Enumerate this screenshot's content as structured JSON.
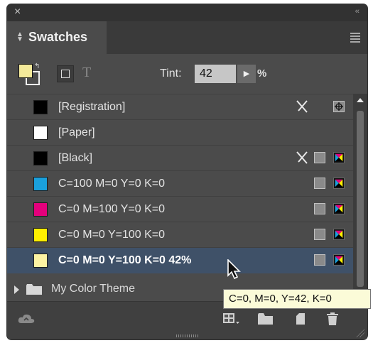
{
  "window": {
    "close_glyph": "×",
    "collapse_glyph": "‹‹"
  },
  "tab": {
    "title": "Swatches",
    "arrows_icon": "up-down-arrows-icon"
  },
  "toolbar": {
    "formatting_text_glyph": "T",
    "tint_label": "Tint:",
    "tint_value": "42",
    "tint_arrow_glyph": "▶",
    "tint_percent": "%"
  },
  "swatches": [
    {
      "label": "[Registration]",
      "color": "#000000"
    },
    {
      "label": "[Paper]",
      "color": "#ffffff"
    },
    {
      "label": "[Black]",
      "color": "#000000"
    },
    {
      "label": "C=100 M=0 Y=0 K=0",
      "color": "#1aa0dc"
    },
    {
      "label": "C=0 M=100 Y=0 K=0",
      "color": "#e4007c"
    },
    {
      "label": "C=0 M=0 Y=100 K=0",
      "color": "#ffef00"
    },
    {
      "label": "C=0 M=0 Y=100 K=0 42%",
      "color": "#fdf3a2"
    }
  ],
  "group": {
    "label": "My Color Theme"
  },
  "tooltip": {
    "text": "C=0, M=0, Y=42, K=0"
  },
  "colors": {
    "panel_bg": "#4b4b4b",
    "selected_row": "#3f5168",
    "tint_field": "#c6c6c6"
  }
}
